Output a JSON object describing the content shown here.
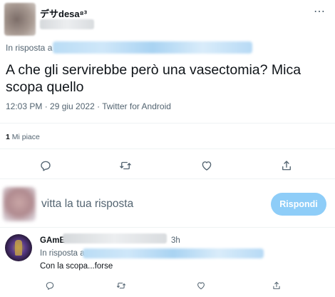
{
  "tweet": {
    "display_name": "デサdesa⁸³",
    "more_glyph": "⋯",
    "reply_prefix": "In risposta a",
    "text": "A che gli servirebbe però una vasectomia? Mica scopa quello",
    "timestamp": "12:03 PM · 29 giu 2022 · Twitter for Android",
    "likes_count": "1",
    "likes_label": "Mi piace",
    "actions": [
      "reply-icon",
      "retweet-icon",
      "like-icon",
      "share-icon"
    ]
  },
  "composer": {
    "placeholder": "Twitta la tua risposta",
    "placeholder_visible": "vitta la tua risposta",
    "reply_button": "Rispondi",
    "accent": "#1d9bf0",
    "button_disabled_color": "#8ecdf8"
  },
  "reply": {
    "display_name": "GAmE",
    "time_ago": "3h",
    "reply_prefix": "In risposta a",
    "text": "Con la scopa...forse"
  }
}
